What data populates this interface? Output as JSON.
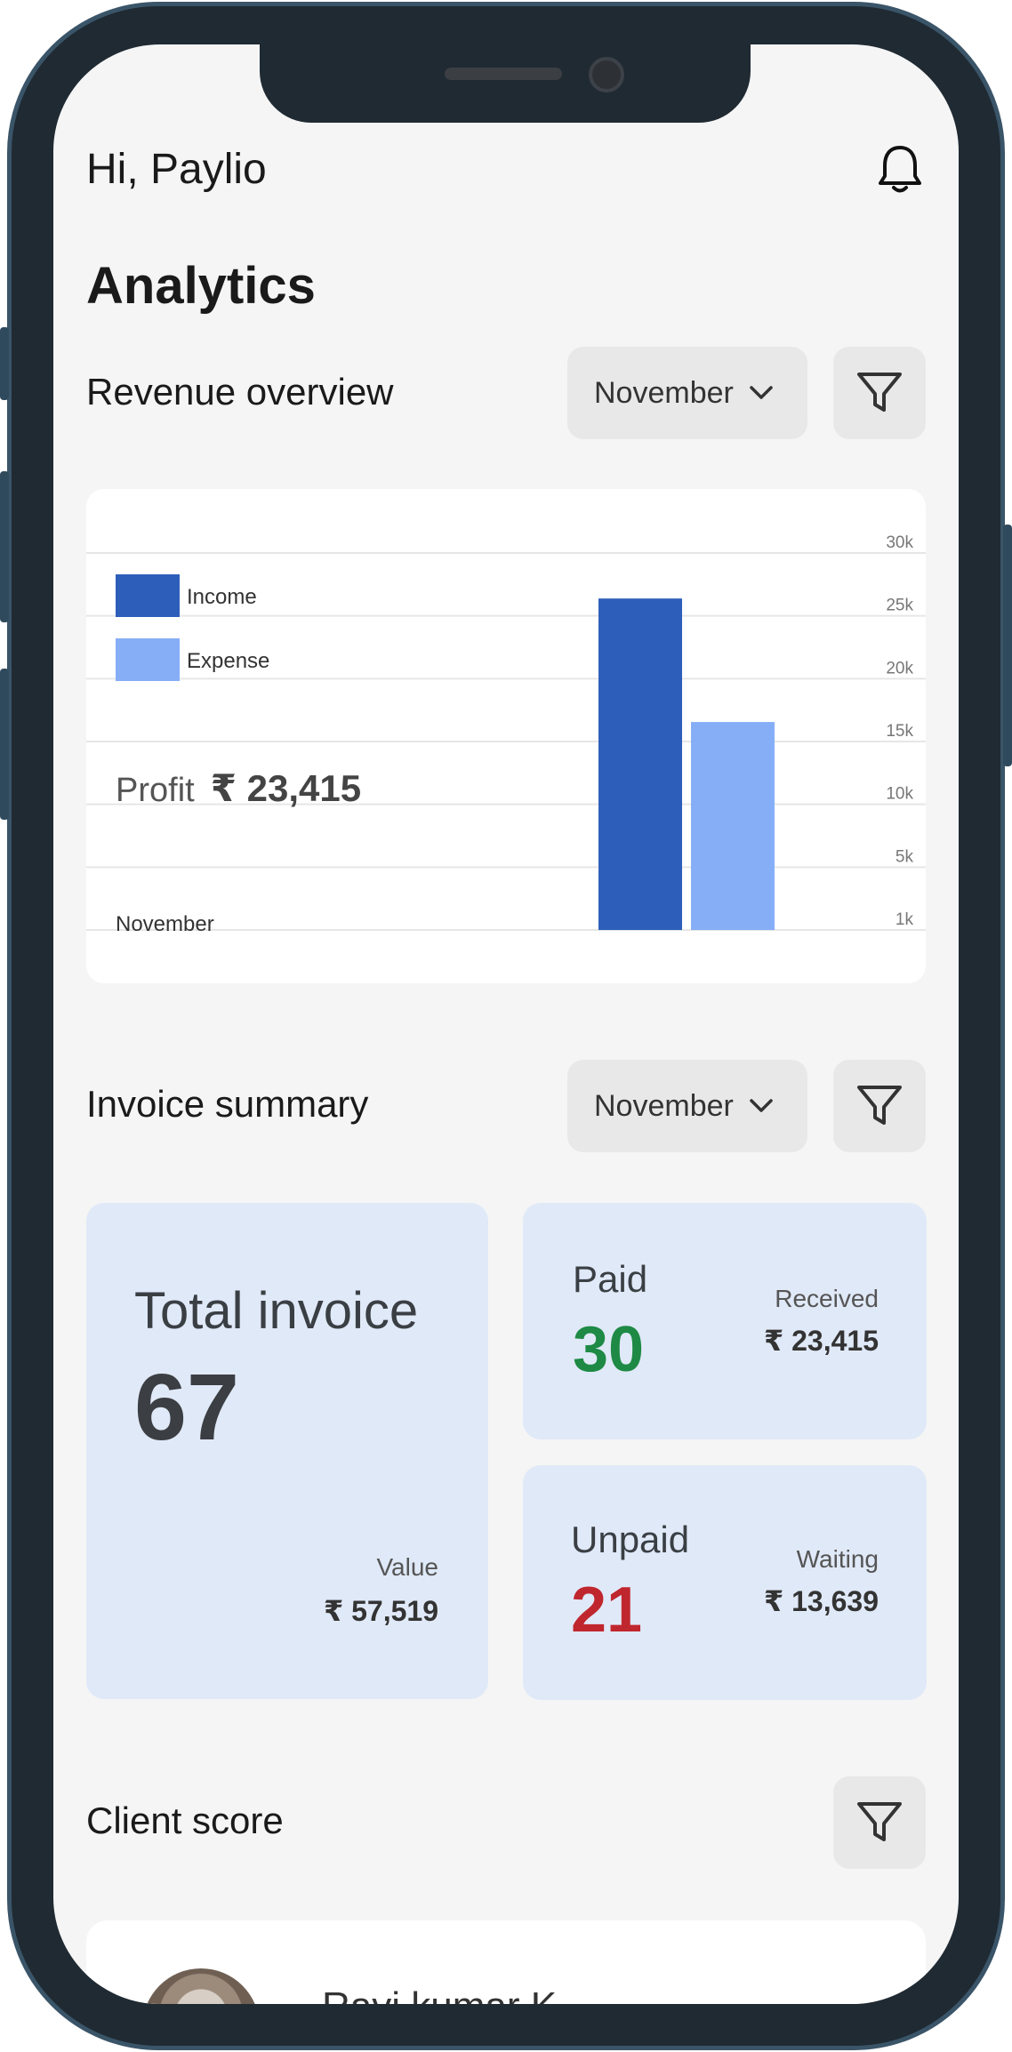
{
  "header": {
    "greeting": "Hi, Paylio",
    "title": "Analytics"
  },
  "revenue": {
    "title": "Revenue overview",
    "month": "November",
    "profit_label": "Profit",
    "profit_value": "₹ 23,415",
    "chart_month_label": "November"
  },
  "chart_data": {
    "type": "bar",
    "categories": [
      "November"
    ],
    "series": [
      {
        "name": "Income",
        "values": [
          26500
        ],
        "color": "#2d5fba"
      },
      {
        "name": "Expense",
        "values": [
          17000
        ],
        "color": "#86aef7"
      }
    ],
    "y_ticks": [
      "1k",
      "5k",
      "10k",
      "15k",
      "20k",
      "25k",
      "30k"
    ],
    "ylim": [
      1000,
      30000
    ],
    "grid": true,
    "legend_position": "top-left"
  },
  "invoice": {
    "title": "Invoice summary",
    "month": "November",
    "total": {
      "label": "Total invoice",
      "count": "67",
      "value_label": "Value",
      "value": "₹ 57,519"
    },
    "paid": {
      "label": "Paid",
      "count": "30",
      "sub_label": "Received",
      "amount": "₹ 23,415",
      "color": "#1e8a45"
    },
    "unpaid": {
      "label": "Unpaid",
      "count": "21",
      "sub_label": "Waiting",
      "amount": "₹ 13,639",
      "color": "#c0262d"
    }
  },
  "client": {
    "title": "Client score",
    "first_name": "Ravi kumar K"
  },
  "icons": {
    "bell": "bell-icon",
    "filter": "filter-icon",
    "chevron": "chevron-down-icon"
  }
}
